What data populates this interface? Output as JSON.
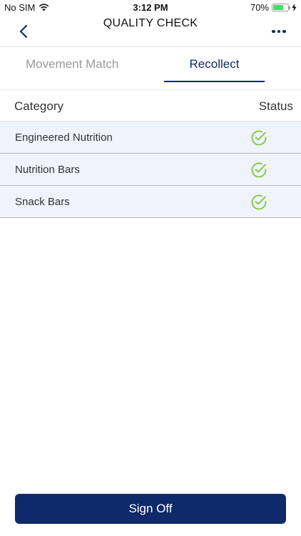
{
  "status_bar": {
    "carrier": "No SIM",
    "time": "3:12 PM",
    "battery_percent": "70%",
    "battery_level": 0.7,
    "icons": [
      "wifi-icon",
      "battery-icon",
      "charging-icon"
    ]
  },
  "nav": {
    "title": "QUALITY CHECK",
    "back_icon": "chevron-left-icon",
    "more_icon": "ellipsis-icon"
  },
  "tabs": [
    {
      "label": "Movement Match",
      "active": false
    },
    {
      "label": "Recollect",
      "active": true
    }
  ],
  "table": {
    "headers": {
      "category": "Category",
      "status": "Status"
    },
    "rows": [
      {
        "category": "Engineered Nutrition",
        "status_icon": "check-circle-icon"
      },
      {
        "category": "Nutrition Bars",
        "status_icon": "check-circle-icon"
      },
      {
        "category": "Snack Bars",
        "status_icon": "check-circle-icon"
      }
    ]
  },
  "footer": {
    "sign_off_label": "Sign Off"
  },
  "colors": {
    "primary": "#0f2a6b",
    "row_background": "#eef3fc",
    "check": "#8cc63f",
    "inactive_tab": "#9a9a9a"
  }
}
